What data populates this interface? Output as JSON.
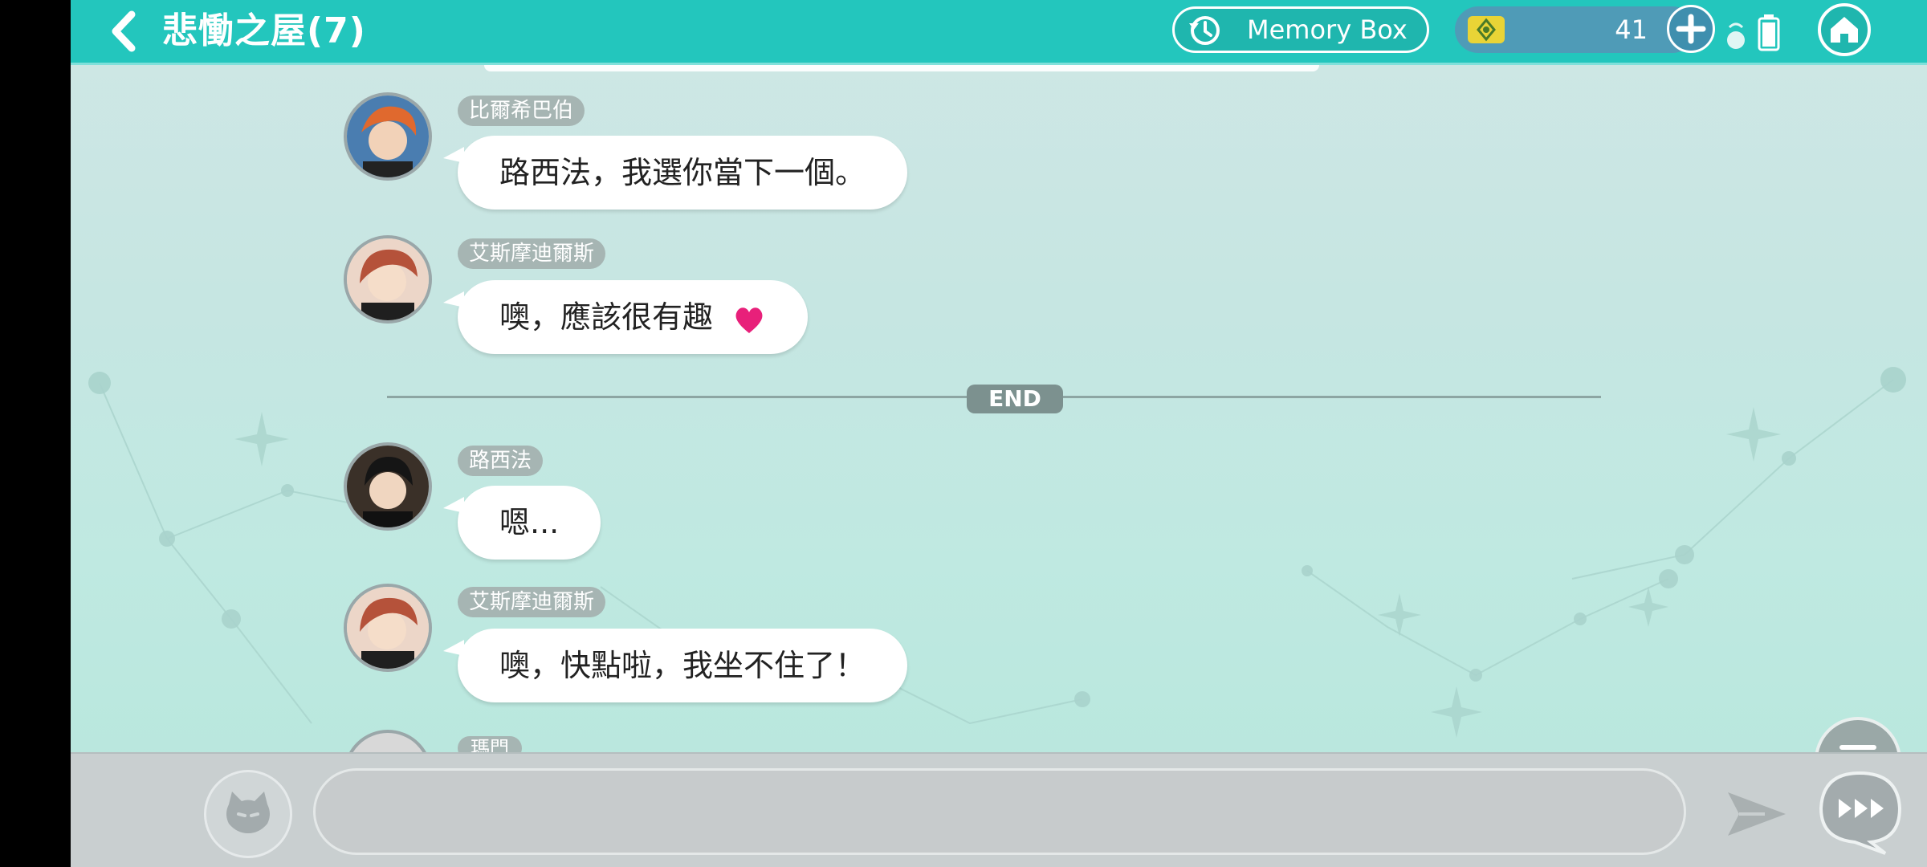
{
  "header": {
    "back_icon": "chevron-left-icon",
    "title": "悲慟之屋(7)",
    "memory_box_label": "Memory Box",
    "currency_count": "41"
  },
  "messages": [
    {
      "name": "比爾希巴伯",
      "text": "路西法，我選你當下一個。"
    },
    {
      "name": "艾斯摩迪爾斯",
      "text": "噢，應該很有趣",
      "emoji": "heart-icon"
    },
    {
      "name": "路西法",
      "text": "嗯..."
    },
    {
      "name": "艾斯摩迪爾斯",
      "text": "噢，快點啦，我坐不住了！"
    },
    {
      "name": "瑪門",
      "text": ""
    }
  ],
  "divider": {
    "label": "END"
  },
  "input": {
    "placeholder": ""
  },
  "colors": {
    "header": "#23c6bd",
    "heart": "#e8207a",
    "bubble": "#ffffff"
  }
}
